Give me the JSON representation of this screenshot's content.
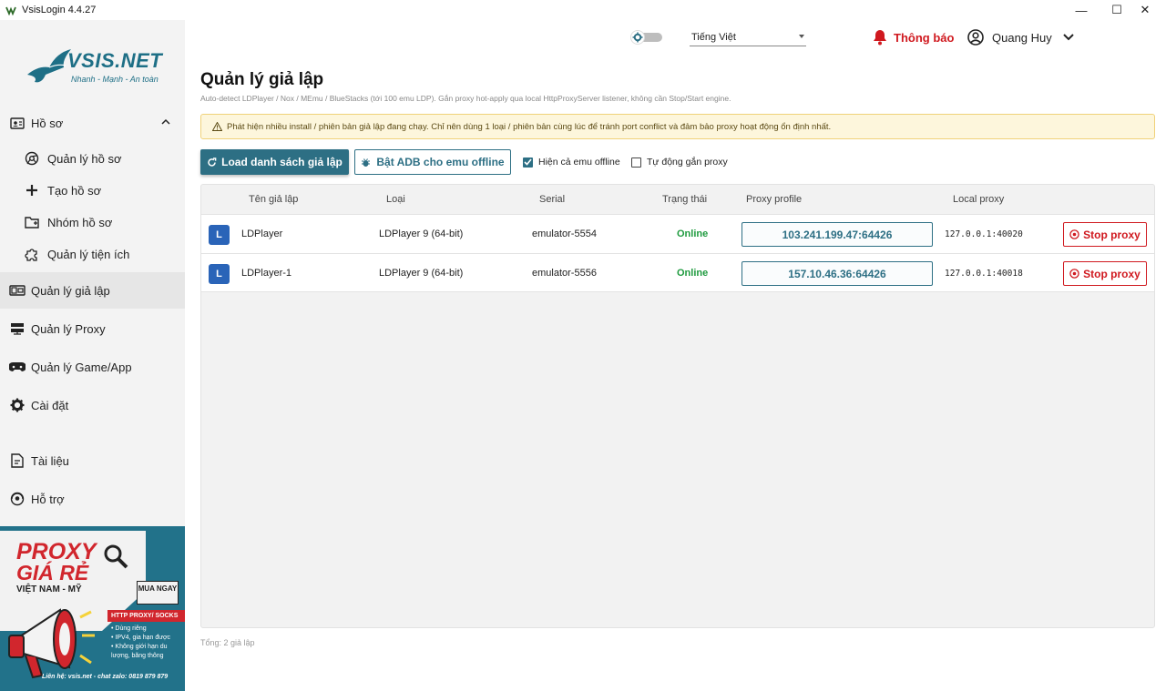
{
  "window": {
    "title": "VsisLogin 4.4.27",
    "min": "—",
    "max": "☐",
    "close": "✕"
  },
  "logo": {
    "brand": "VSIS.NET",
    "slogan": "Nhanh - Mạnh - An toàn"
  },
  "sidebar": {
    "items": [
      {
        "label": "Hồ sơ",
        "icon": "profile-icon"
      },
      {
        "label": "Quản lý hồ sơ",
        "icon": "browser-icon"
      },
      {
        "label": "Tạo hồ sơ",
        "icon": "plus-icon"
      },
      {
        "label": "Nhóm hồ sơ",
        "icon": "folder-icon"
      },
      {
        "label": "Quản lý tiện ích",
        "icon": "puzzle-icon"
      },
      {
        "label": "Quản lý giả lập",
        "icon": "emulator-icon"
      },
      {
        "label": "Quản lý Proxy",
        "icon": "server-icon"
      },
      {
        "label": "Quản lý Game/App",
        "icon": "gamepad-icon"
      },
      {
        "label": "Cài đặt",
        "icon": "gear-icon"
      },
      {
        "label": "Tài liệu",
        "icon": "document-icon"
      },
      {
        "label": "Hỗ trợ",
        "icon": "support-icon"
      }
    ]
  },
  "banner": {
    "title1": "PROXY",
    "title2": "GIÁ RẺ",
    "region": "VIỆT NAM - MỸ",
    "buy": "MUA NGAY",
    "tag": "HTTP PROXY/ SOCKS",
    "features": [
      "• Dùng riêng",
      "• IPV4, gia hạn được",
      "• Không giới hạn du",
      "  lượng, băng thông"
    ],
    "contact": "Liên hệ: vsis.net - chat zalo: 0819 879 879"
  },
  "topbar": {
    "language": "Tiếng Việt",
    "notification": "Thông báo",
    "user": "Quang Huy"
  },
  "page": {
    "title": "Quản lý giả lập",
    "description": "Auto-detect LDPlayer / Nox / MEmu / BlueStacks (tới 100 emu LDP). Gắn proxy hot-apply qua local HttpProxyServer listener, không cần Stop/Start engine.",
    "alert": "Phát hiện nhiều install / phiên bản giả lập đang chạy. Chỉ nên dùng 1 loại / phiên bản cùng lúc để tránh port conflict và đảm bảo proxy hoạt động ổn định nhất."
  },
  "toolbar": {
    "load_label": "Load danh sách giả lập",
    "adb_label": "Bật ADB cho emu offline",
    "show_offline_label": "Hiện cả emu offline",
    "show_offline_checked": true,
    "auto_proxy_label": "Tự động gắn proxy",
    "auto_proxy_checked": false
  },
  "table": {
    "headers": [
      "Tên giả lập",
      "Loại",
      "Serial",
      "Trạng thái",
      "Proxy profile",
      "Local proxy"
    ],
    "rows": [
      {
        "badge": "L",
        "name": "LDPlayer",
        "type": "LDPlayer 9 (64-bit)",
        "serial": "emulator-5554",
        "status": "Online",
        "proxy": "103.241.199.47:64426",
        "local": "127.0.0.1:40020",
        "action": "Stop proxy"
      },
      {
        "badge": "L",
        "name": "LDPlayer-1",
        "type": "LDPlayer 9 (64-bit)",
        "serial": "emulator-5556",
        "status": "Online",
        "proxy": "157.10.46.36:64426",
        "local": "127.0.0.1:40018",
        "action": "Stop proxy"
      }
    ]
  },
  "footer": {
    "count": "Tổng: 2 giả lập"
  },
  "colors": {
    "accent": "#2d6f84",
    "danger": "#d0191f",
    "online": "#1f9b3f",
    "badge": "#2a64b8"
  }
}
